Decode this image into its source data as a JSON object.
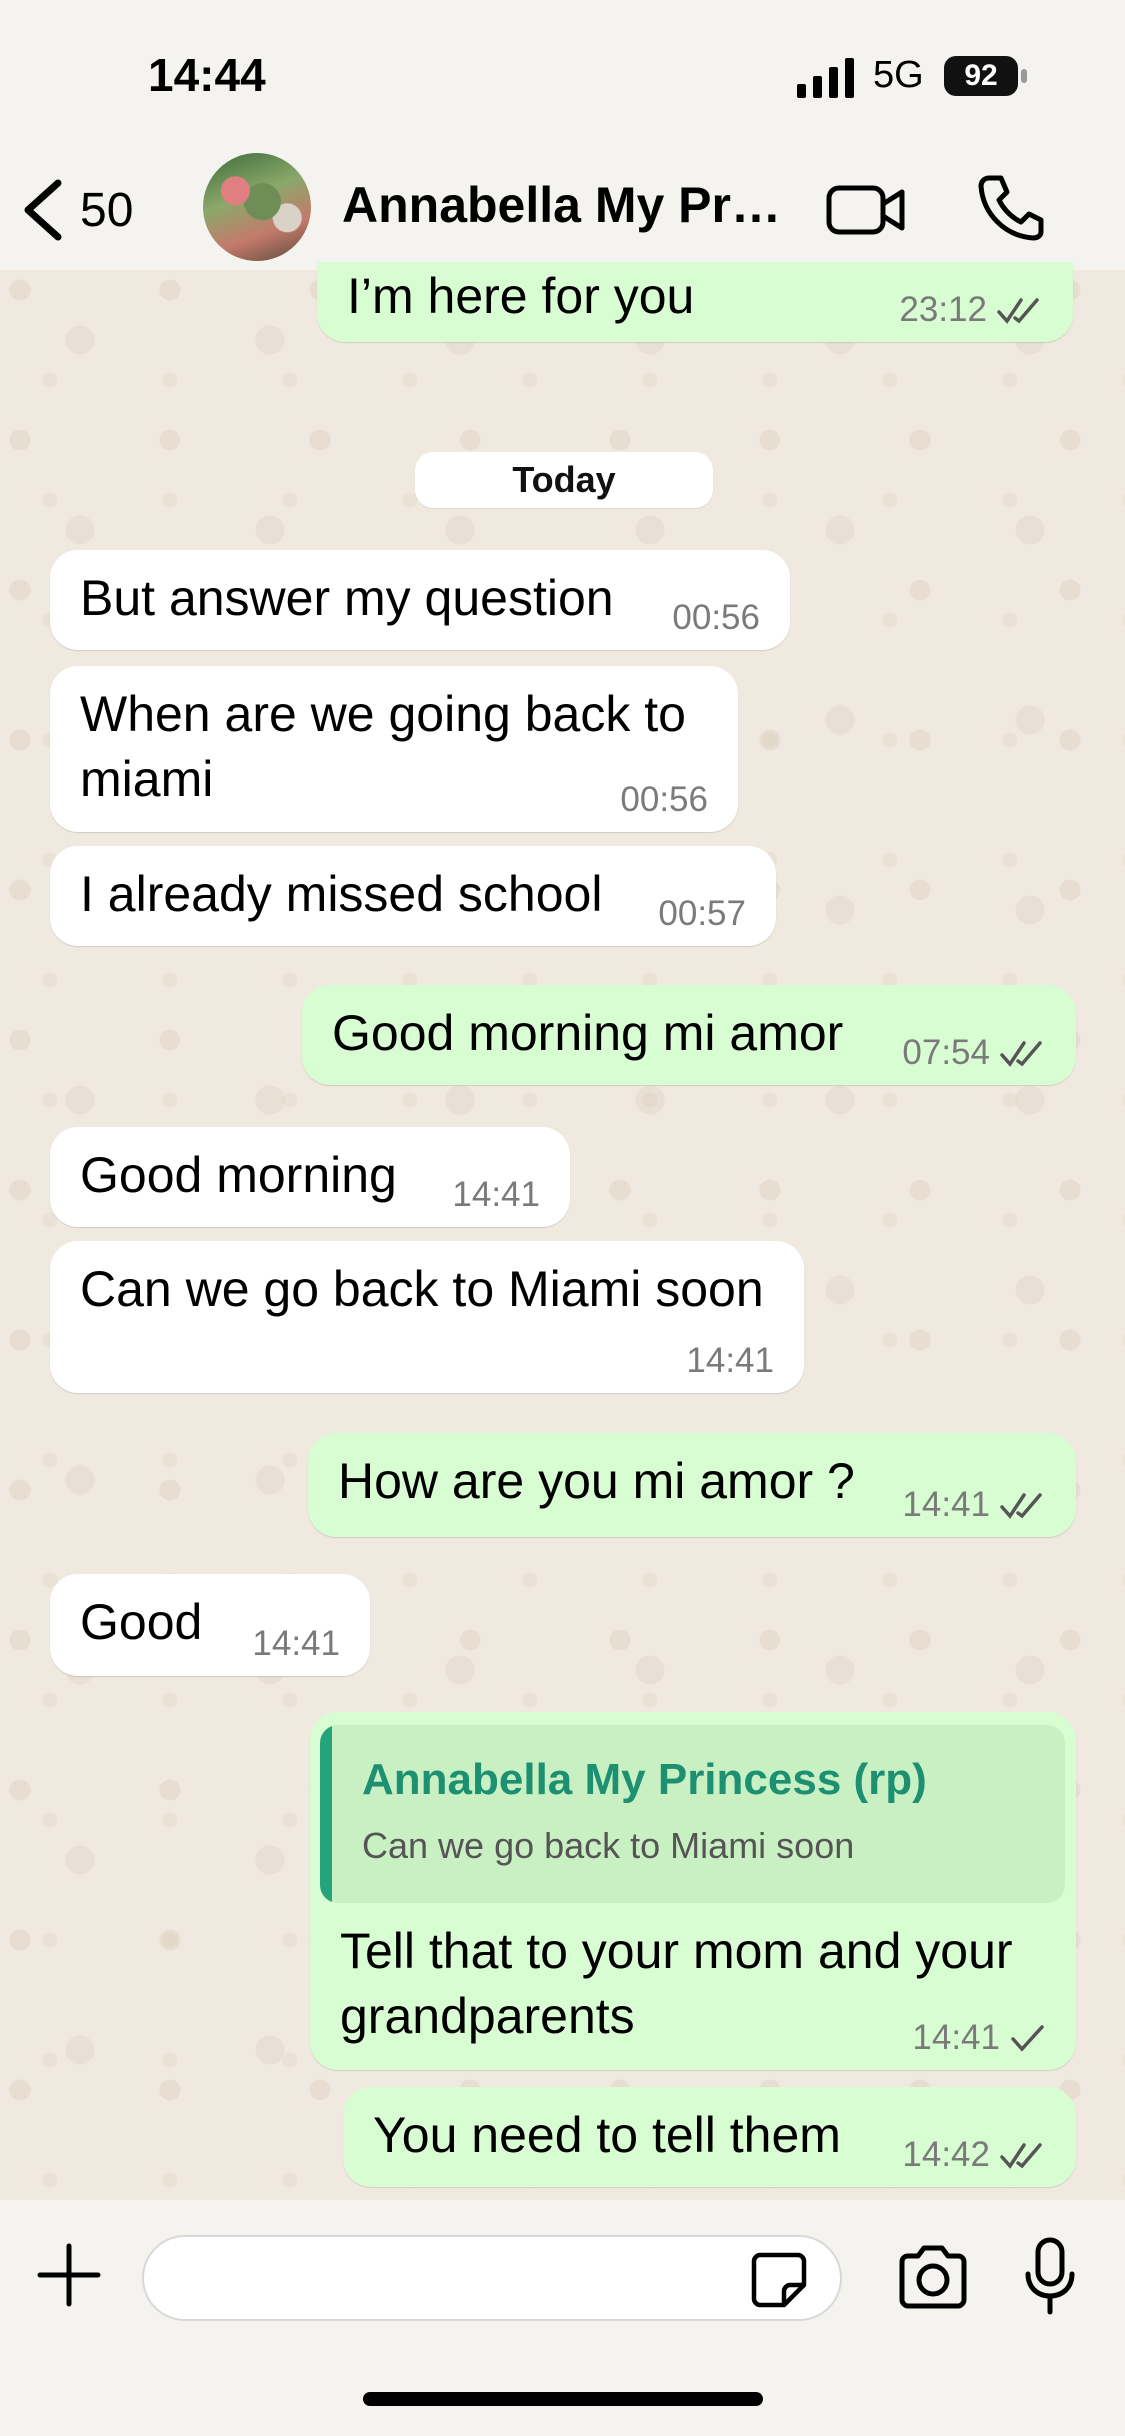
{
  "status_bar": {
    "time": "14:44",
    "network": "5G",
    "battery": "92"
  },
  "header": {
    "back_count": "50",
    "contact_name": "Annabella My Prin…",
    "icons": [
      "chevron-left-icon",
      "video-call-icon",
      "phone-icon"
    ]
  },
  "messages": [
    {
      "dir": "out",
      "text": "I’m here for you",
      "time": "23:12",
      "status": "read"
    },
    {
      "dir": "date",
      "text": "Today"
    },
    {
      "dir": "in",
      "text": "But answer my question",
      "time": "00:56"
    },
    {
      "dir": "in",
      "text": "When are we going back to miami",
      "time": "00:56"
    },
    {
      "dir": "in",
      "text": "I already missed school",
      "time": "00:57"
    },
    {
      "dir": "out",
      "text": "Good morning mi amor",
      "time": "07:54",
      "status": "read"
    },
    {
      "dir": "in",
      "text": "Good morning",
      "time": "14:41"
    },
    {
      "dir": "in",
      "text": "Can we go back to Miami soon",
      "time": "14:41"
    },
    {
      "dir": "out",
      "text": "How are you mi amor ?",
      "time": "14:41",
      "status": "read"
    },
    {
      "dir": "in",
      "text": "Good",
      "time": "14:41"
    },
    {
      "dir": "out",
      "text": "Tell that to your mom and your grandparents",
      "time": "14:41",
      "status": "sent",
      "reply_to": {
        "author": "Annabella My Princess (rp)",
        "text": "Can we go back to Miami soon"
      }
    },
    {
      "dir": "out",
      "text": "You need to tell them",
      "time": "14:42",
      "status": "read"
    }
  ],
  "composer": {
    "placeholder": "",
    "icons": [
      "plus-icon",
      "sticker-icon",
      "camera-icon",
      "microphone-icon"
    ]
  },
  "colors": {
    "outgoing_bubble": "#d9fdd3",
    "incoming_bubble": "#ffffff",
    "quote_accent": "#25a37a",
    "background": "#efe9df"
  }
}
